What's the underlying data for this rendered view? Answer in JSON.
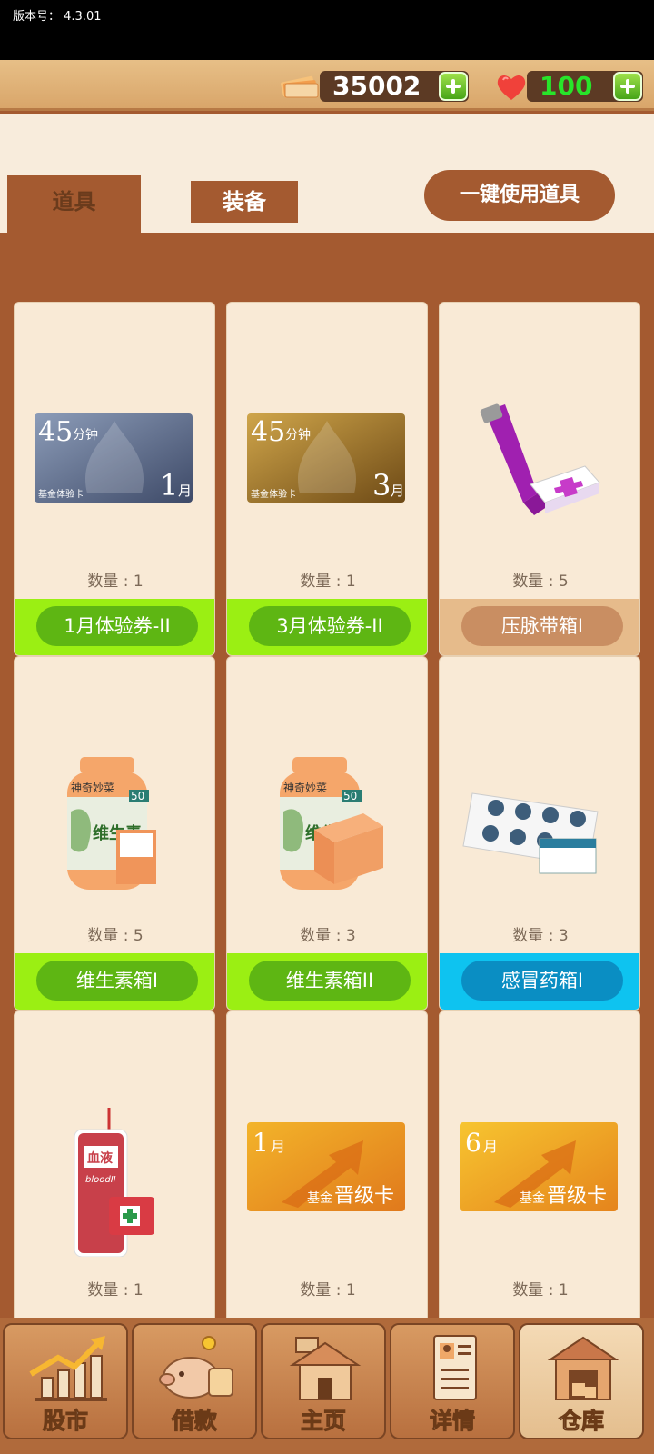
{
  "status": {
    "version_label": "版本号：  4.3.01"
  },
  "currency": {
    "money": "35002",
    "hearts": "100"
  },
  "tabs": {
    "props": "道具",
    "equipment": "装备"
  },
  "actions": {
    "use_all": "一键使用道具"
  },
  "items": [
    {
      "name": "1月体验券-II",
      "quantity": "数量 : 1",
      "card_title": "45",
      "card_unit": "分钟",
      "card_month": "1",
      "card_month_unit": "月",
      "card_sub": "基金体验卡",
      "theme": "green"
    },
    {
      "name": "3月体验券-II",
      "quantity": "数量 : 1",
      "card_title": "45",
      "card_unit": "分钟",
      "card_month": "3",
      "card_month_unit": "月",
      "card_sub": "基金体验卡",
      "theme": "green"
    },
    {
      "name": "压脉带箱I",
      "quantity": "数量 : 5",
      "theme": "tan"
    },
    {
      "name": "维生素箱I",
      "quantity": "数量 : 5",
      "label_50": "50",
      "label_vit": "维生素",
      "theme": "green"
    },
    {
      "name": "维生素箱II",
      "quantity": "数量 : 3",
      "label_50": "50",
      "label_vit": "维生",
      "theme": "green"
    },
    {
      "name": "感冒药箱I",
      "quantity": "数量 : 3",
      "theme": "blue"
    },
    {
      "name": "",
      "quantity": "数量 : 1",
      "bag_text": "血液",
      "bag_sub": "bloodII"
    },
    {
      "name": "",
      "quantity": "数量 : 1",
      "card_month": "1",
      "card_month_unit": "月",
      "card_sub": "基金",
      "card_big": "晋级卡"
    },
    {
      "name": "",
      "quantity": "数量 : 1",
      "card_month": "6",
      "card_month_unit": "月",
      "card_sub": "基金",
      "card_big": "晋级卡"
    }
  ],
  "nav": [
    {
      "label": "股市"
    },
    {
      "label": "借款"
    },
    {
      "label": "主页"
    },
    {
      "label": "详情"
    },
    {
      "label": "仓库"
    }
  ]
}
